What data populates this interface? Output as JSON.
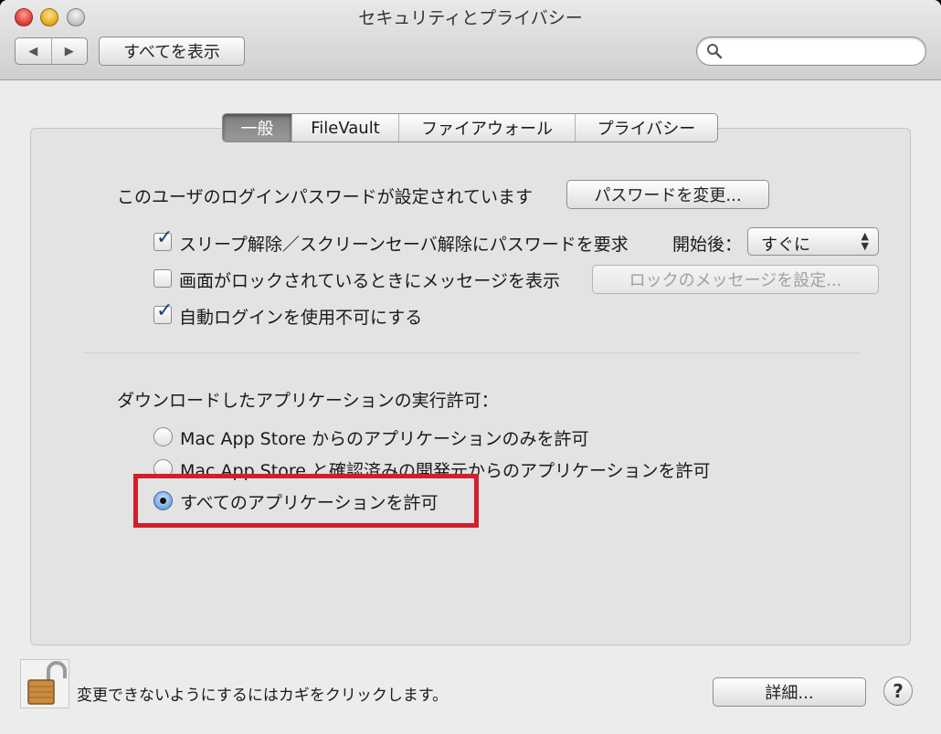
{
  "window": {
    "title": "セキュリティとプライバシー"
  },
  "toolbar": {
    "back": "◀",
    "forward": "▶",
    "show_all": "すべてを表示",
    "search_placeholder": ""
  },
  "tabs": [
    {
      "label": "一般",
      "selected": true
    },
    {
      "label": "FileVault",
      "selected": false
    },
    {
      "label": "ファイアウォール",
      "selected": false
    },
    {
      "label": "プライバシー",
      "selected": false
    }
  ],
  "general": {
    "password_text": "このユーザのログインパスワードが設定されています",
    "change_password_button": "パスワードを変更...",
    "require_password": {
      "label": "スリープ解除／スクリーンセーバ解除にパスワードを要求",
      "checked": true
    },
    "start_after_label": "開始後：",
    "start_after_value": "すぐに",
    "lock_message": {
      "label": "画面がロックされているときにメッセージを表示",
      "checked": false
    },
    "lock_message_button": "ロックのメッセージを設定...",
    "disable_autologin": {
      "label": "自動ログインを使用不可にする",
      "checked": true
    },
    "downloads_heading": "ダウンロードしたアプリケーションの実行許可：",
    "options": [
      {
        "label": "Mac App Store からのアプリケーションのみを許可",
        "selected": false
      },
      {
        "label": "Mac App Store と確認済みの開発元からのアプリケーションを許可",
        "selected": false
      },
      {
        "label": "すべてのアプリケーションを許可",
        "selected": true
      }
    ]
  },
  "footer": {
    "lock_text": "変更できないようにするにはカギをクリックします。",
    "advanced_button": "詳細...",
    "help": "?"
  },
  "colors": {
    "highlight": "#d1202a",
    "checkmark": "#1b3f78"
  }
}
